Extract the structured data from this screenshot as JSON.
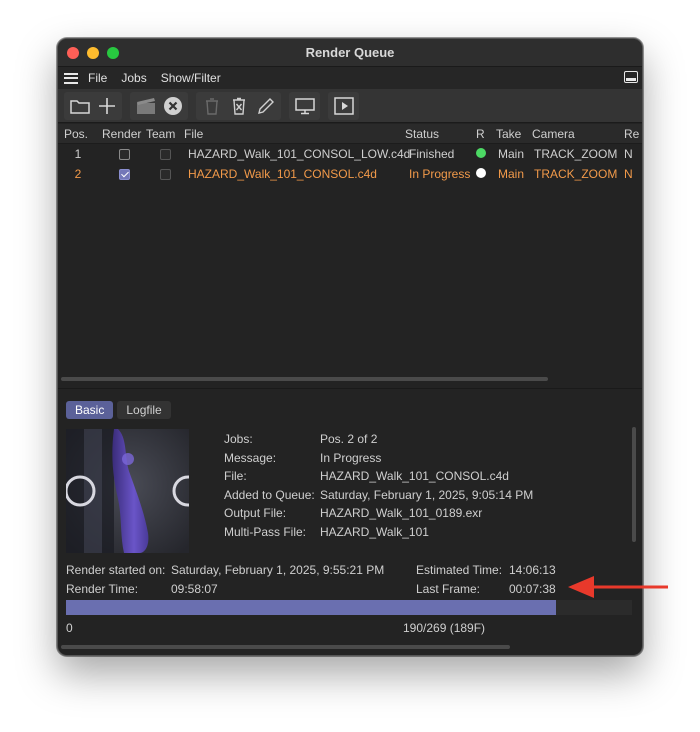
{
  "window": {
    "title": "Render Queue"
  },
  "menu": {
    "items": [
      "File",
      "Jobs",
      "Show/Filter"
    ]
  },
  "toolbar": {
    "icons": [
      "folder-icon",
      "plus-icon",
      "clapperboard-icon",
      "stop-icon",
      "trash-icon",
      "delete-job-icon",
      "pencil-icon",
      "monitor-icon",
      "play-icon"
    ]
  },
  "table": {
    "columns": [
      "Pos.",
      "Render",
      "Team",
      "File",
      "Status",
      "R",
      "Take",
      "Camera",
      "Re"
    ],
    "rows": [
      {
        "pos": "1",
        "render": false,
        "team": false,
        "file": "HAZARD_Walk_101_CONSOL_LOW.c4d",
        "status": "Finished",
        "r_color": "#4cd964",
        "take": "Main",
        "camera": "TRACK_ZOOM",
        "re": "N"
      },
      {
        "pos": "2",
        "render": true,
        "team": false,
        "file": "HAZARD_Walk_101_CONSOL.c4d",
        "status": "In Progress",
        "r_color": "#ffffff",
        "take": "Main",
        "camera": "TRACK_ZOOM",
        "re": "N"
      }
    ]
  },
  "tabs": [
    "Basic",
    "Logfile"
  ],
  "details": {
    "jobs_label": "Jobs:",
    "jobs": "Pos. 2 of 2",
    "message_label": "Message:",
    "message": "In Progress",
    "file_label": "File:",
    "file": "HAZARD_Walk_101_CONSOL.c4d",
    "added_label": "Added to Queue:",
    "added": "Saturday, February 1, 2025, 9:05:14 PM",
    "output_label": "Output File:",
    "output": "HAZARD_Walk_101_0189.exr",
    "multipass_label": "Multi-Pass File:",
    "multipass": "HAZARD_Walk_101"
  },
  "stats": {
    "started_label": "Render started on:",
    "started": "Saturday, February 1, 2025, 9:55:21 PM",
    "render_time_label": "Render Time:",
    "render_time": "09:58:07",
    "estimated_label": "Estimated Time:",
    "estimated": "14:06:13",
    "last_frame_label": "Last Frame:",
    "last_frame": "00:07:38"
  },
  "progress": {
    "fraction": 0.8657,
    "start": "0",
    "label": "190/269 (189F)"
  },
  "colors": {
    "accent": "#5b6199",
    "active_row": "#f29a4a",
    "annotation_arrow": "#e8392b"
  }
}
